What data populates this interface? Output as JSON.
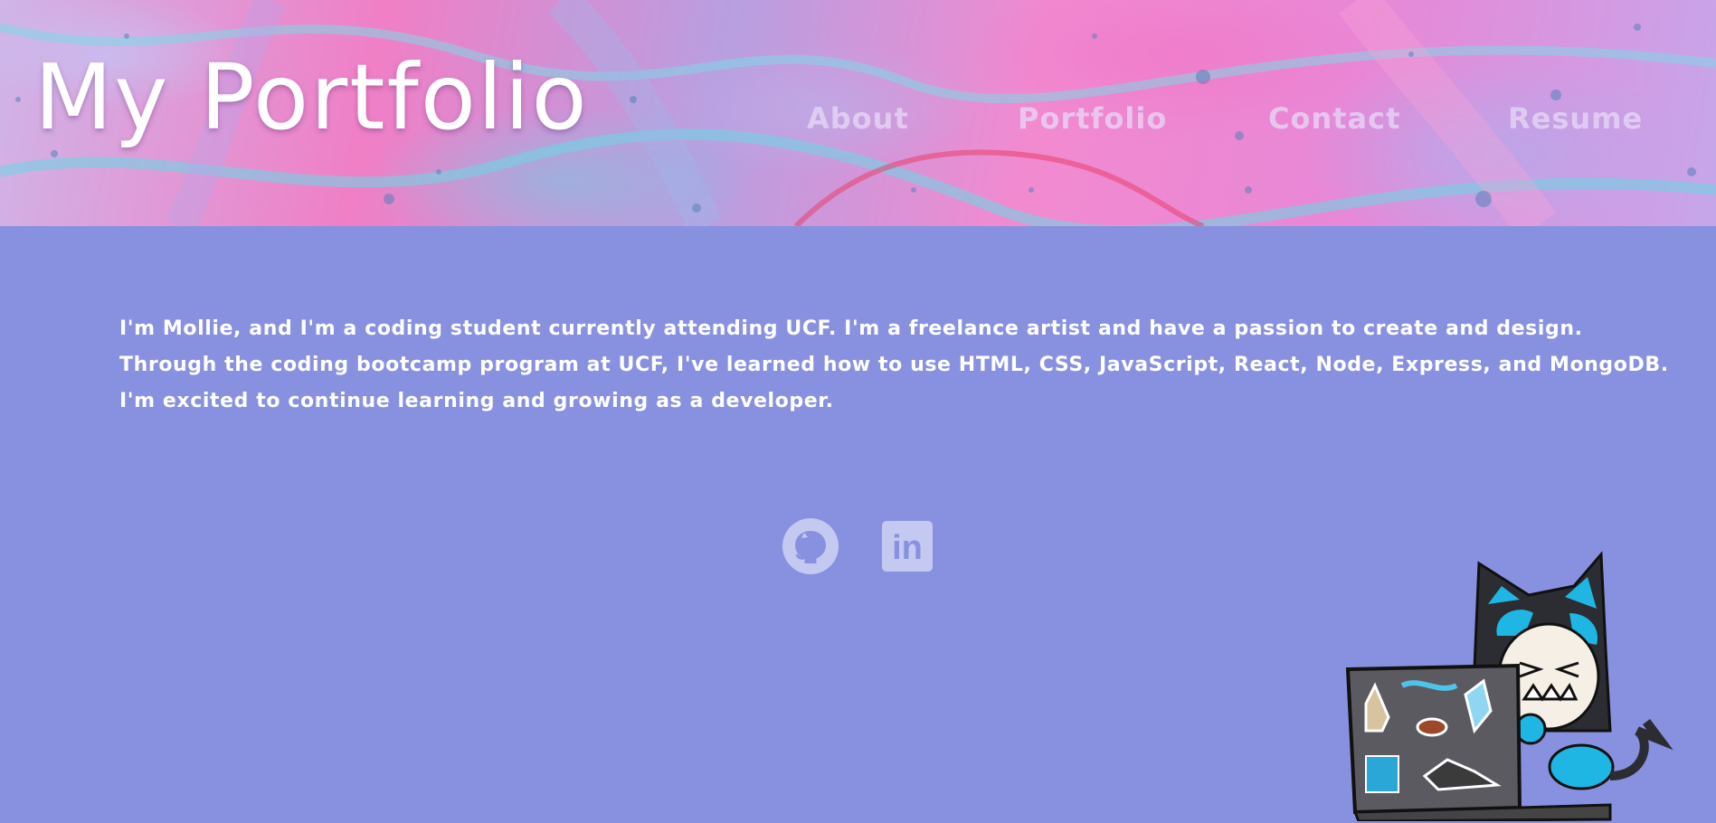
{
  "header": {
    "title": "My Portfolio",
    "nav": [
      {
        "label": "About"
      },
      {
        "label": "Portfolio"
      },
      {
        "label": "Contact"
      },
      {
        "label": "Resume"
      }
    ]
  },
  "about": {
    "lines": [
      "I'm Mollie, and I'm a coding student currently attending UCF. I'm a freelance artist and have a passion to create and design.",
      "Through the coding bootcamp program at UCF, I've learned how to use HTML, CSS, JavaScript, React, Node, Express, and MongoDB.",
      "I'm excited to continue learning and growing as a developer."
    ]
  },
  "social": {
    "icons": [
      "github-icon",
      "linkedin-icon"
    ],
    "linkedin_glyph": "in"
  },
  "colors": {
    "page_background": "#8891e0",
    "icon_color": "#c4c9f2",
    "nav_text": "#e6d7f5"
  }
}
